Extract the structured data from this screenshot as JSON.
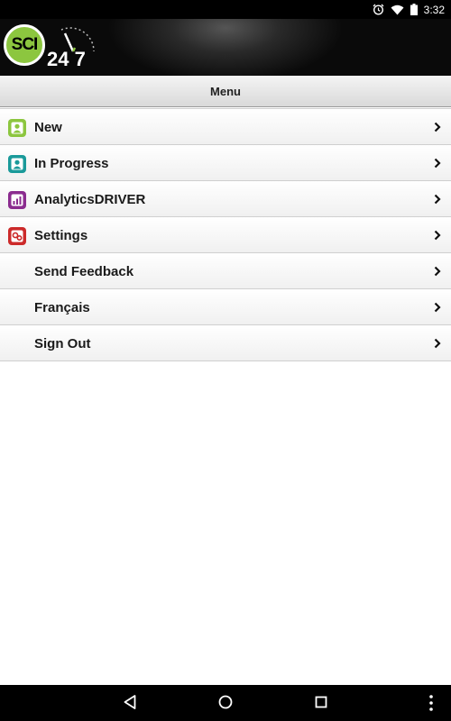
{
  "status_bar": {
    "time": "3:32",
    "icons": [
      "alarm-icon",
      "wifi-icon",
      "battery-icon"
    ]
  },
  "header": {
    "logo_text": "SCI",
    "logo_number": "24 7"
  },
  "title_bar": {
    "title": "Menu"
  },
  "menu": {
    "items": [
      {
        "label": "New",
        "icon": "new-person-icon",
        "icon_color": "#8cc63f"
      },
      {
        "label": "In Progress",
        "icon": "in-progress-person-icon",
        "icon_color": "#1a9a9a"
      },
      {
        "label": "AnalyticsDRIVER",
        "icon": "analytics-icon",
        "icon_color": "#8b2c8f"
      },
      {
        "label": "Settings",
        "icon": "settings-icon",
        "icon_color": "#cc2a2a"
      },
      {
        "label": "Send Feedback",
        "icon": "",
        "icon_color": ""
      },
      {
        "label": "Français",
        "icon": "",
        "icon_color": ""
      },
      {
        "label": "Sign Out",
        "icon": "",
        "icon_color": ""
      }
    ]
  },
  "nav_bar": {
    "buttons": [
      "back-icon",
      "home-icon",
      "recents-icon",
      "overflow-menu-icon"
    ]
  },
  "colors": {
    "accent_green": "#8cc63f",
    "header_bg": "#0a0a0a"
  }
}
